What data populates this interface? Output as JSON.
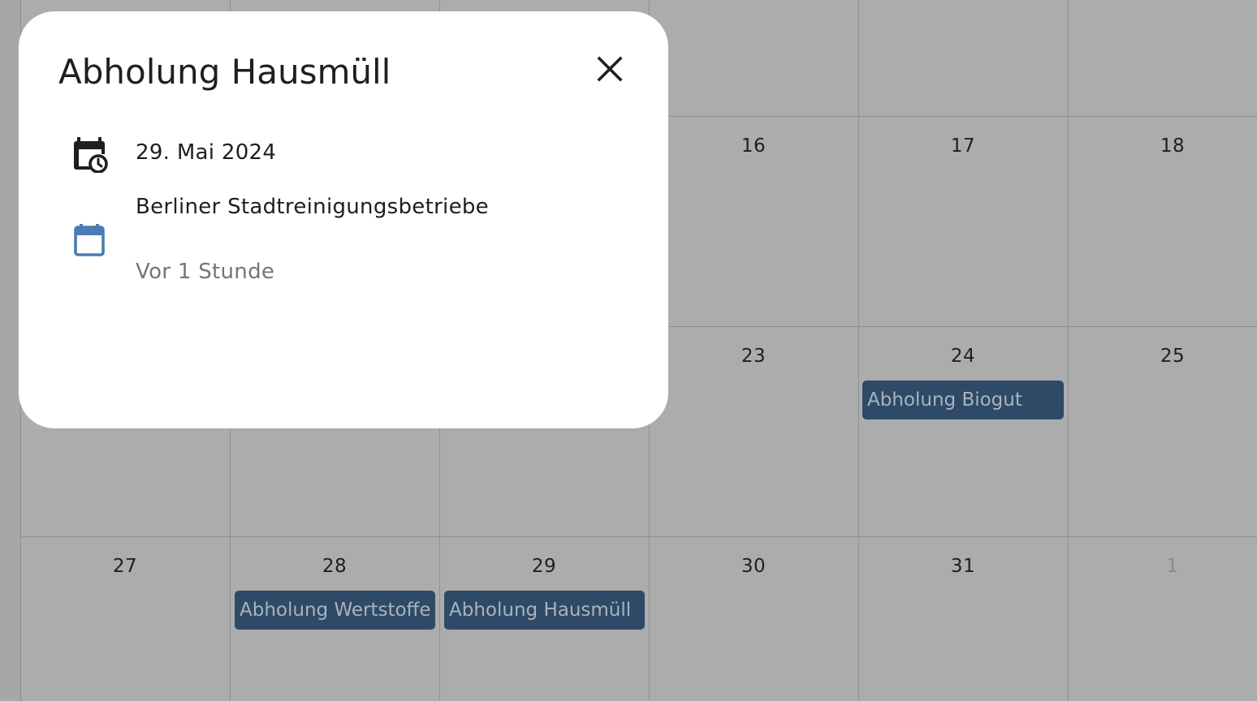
{
  "calendar": {
    "rows": [
      {
        "days": [
          {
            "label": "",
            "muted": false
          },
          {
            "label": "",
            "muted": false
          },
          {
            "label": "",
            "muted": false
          },
          {
            "label": "16",
            "muted": false
          },
          {
            "label": "17",
            "muted": false
          },
          {
            "label": "18",
            "muted": false
          }
        ]
      },
      {
        "days": [
          {
            "label": "",
            "muted": false
          },
          {
            "label": "",
            "muted": false
          },
          {
            "label": "",
            "muted": false
          },
          {
            "label": "23",
            "muted": false
          },
          {
            "label": "24",
            "muted": false
          },
          {
            "label": "25",
            "muted": false
          }
        ]
      },
      {
        "days": [
          {
            "label": "27",
            "muted": false
          },
          {
            "label": "28",
            "muted": false
          },
          {
            "label": "29",
            "muted": false
          },
          {
            "label": "30",
            "muted": false
          },
          {
            "label": "31",
            "muted": false
          },
          {
            "label": "1",
            "muted": true
          }
        ]
      }
    ],
    "events": [
      {
        "label": "Abholung Biogut"
      },
      {
        "label": "Abholung Wertstoffe (A"
      },
      {
        "label": "Abholung Hausmüll"
      }
    ],
    "colors": {
      "background": "#acacac",
      "event": "#2e4a67",
      "event_text": "#a9b3bd"
    }
  },
  "dialog": {
    "title": "Abholung Hausmüll",
    "close_icon": "close-icon",
    "date": "29. Mai 2024",
    "date_icon": "calendar-clock-icon",
    "calendar_name": "Berliner Stadtreinigungsbetriebe",
    "calendar_icon": "calendar-icon",
    "calendar_icon_color": "#4a7bb5",
    "relative_time": "Vor 1 Stunde"
  }
}
